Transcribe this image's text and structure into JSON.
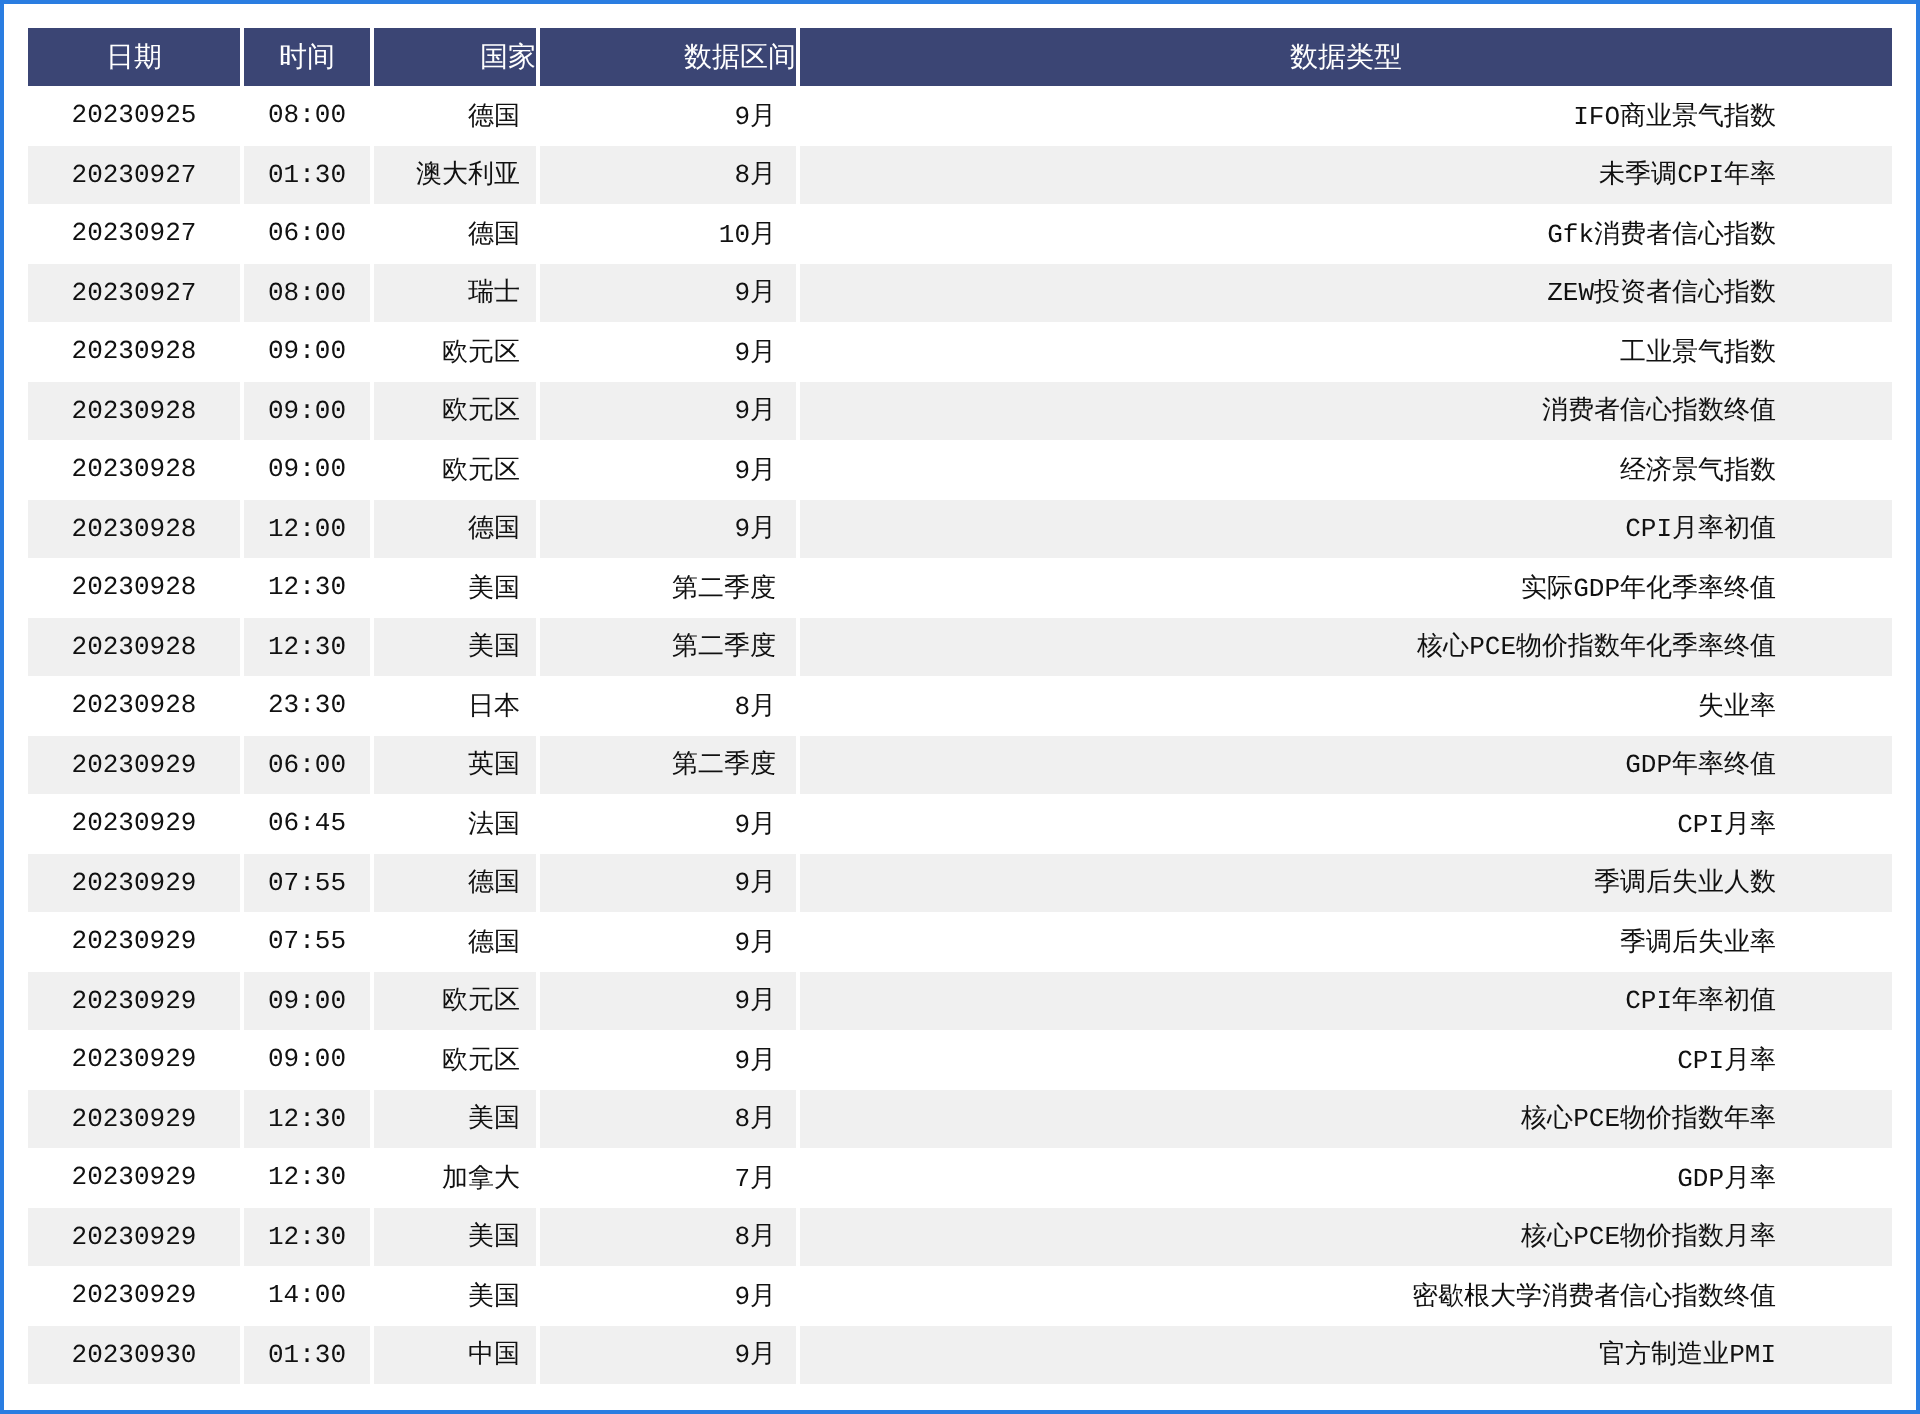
{
  "table": {
    "columns": [
      "日期",
      "时间",
      "国家",
      "数据区间",
      "数据类型"
    ],
    "rows": [
      [
        "20230925",
        "08:00",
        "德国",
        "9月",
        "IFO商业景气指数"
      ],
      [
        "20230927",
        "01:30",
        "澳大利亚",
        "8月",
        "未季调CPI年率"
      ],
      [
        "20230927",
        "06:00",
        "德国",
        "10月",
        "Gfk消费者信心指数"
      ],
      [
        "20230927",
        "08:00",
        "瑞士",
        "9月",
        "ZEW投资者信心指数"
      ],
      [
        "20230928",
        "09:00",
        "欧元区",
        "9月",
        "工业景气指数"
      ],
      [
        "20230928",
        "09:00",
        "欧元区",
        "9月",
        "消费者信心指数终值"
      ],
      [
        "20230928",
        "09:00",
        "欧元区",
        "9月",
        "经济景气指数"
      ],
      [
        "20230928",
        "12:00",
        "德国",
        "9月",
        "CPI月率初值"
      ],
      [
        "20230928",
        "12:30",
        "美国",
        "第二季度",
        "实际GDP年化季率终值"
      ],
      [
        "20230928",
        "12:30",
        "美国",
        "第二季度",
        "核心PCE物价指数年化季率终值"
      ],
      [
        "20230928",
        "23:30",
        "日本",
        "8月",
        "失业率"
      ],
      [
        "20230929",
        "06:00",
        "英国",
        "第二季度",
        "GDP年率终值"
      ],
      [
        "20230929",
        "06:45",
        "法国",
        "9月",
        "CPI月率"
      ],
      [
        "20230929",
        "07:55",
        "德国",
        "9月",
        "季调后失业人数"
      ],
      [
        "20230929",
        "07:55",
        "德国",
        "9月",
        "季调后失业率"
      ],
      [
        "20230929",
        "09:00",
        "欧元区",
        "9月",
        "CPI年率初值"
      ],
      [
        "20230929",
        "09:00",
        "欧元区",
        "9月",
        "CPI月率"
      ],
      [
        "20230929",
        "12:30",
        "美国",
        "8月",
        "核心PCE物价指数年率"
      ],
      [
        "20230929",
        "12:30",
        "加拿大",
        "7月",
        "GDP月率"
      ],
      [
        "20230929",
        "12:30",
        "美国",
        "8月",
        "核心PCE物价指数月率"
      ],
      [
        "20230929",
        "14:00",
        "美国",
        "9月",
        "密歇根大学消费者信心指数终值"
      ],
      [
        "20230930",
        "01:30",
        "中国",
        "9月",
        "官方制造业PMI"
      ]
    ]
  }
}
